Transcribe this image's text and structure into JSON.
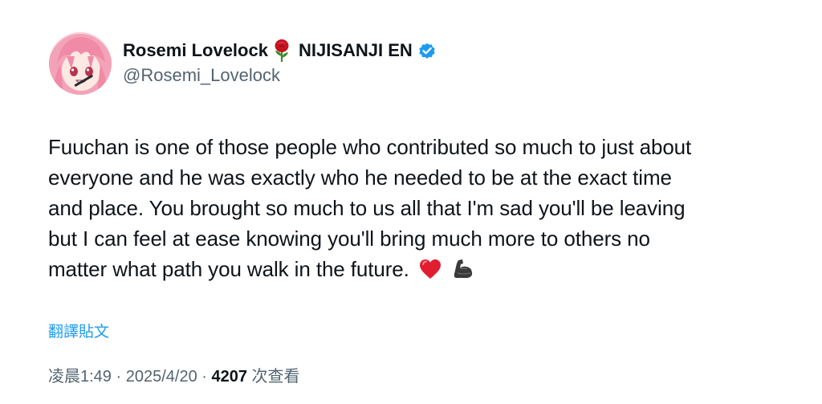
{
  "author": {
    "display_name_part1": "Rosemi Lovelock",
    "display_name_part2": "NIJISANJI EN",
    "handle": "@Rosemi_Lovelock",
    "name_icon": "rose-icon",
    "verified_icon": "verified-badge-icon",
    "verified_color": "#1d9bf0"
  },
  "tweet": {
    "lines": [
      "Fuuchan is one of those people who contributed so much to just about",
      "everyone and he was exactly who he needed to be at the exact time",
      "and place. You brought so much to us all that I'm sad you'll be leaving",
      "but I can feel at ease knowing you'll bring much more to others no",
      "matter what path you walk in the future."
    ],
    "trailing_emojis": [
      "red-heart-icon",
      "flexed-biceps-icon"
    ]
  },
  "translate_label": "翻譯貼文",
  "meta": {
    "time": "凌晨1:49",
    "separator": " · ",
    "date": "2025/4/20",
    "views_count": "4207",
    "views_label": "次查看"
  },
  "colors": {
    "text_primary": "#0f1419",
    "text_secondary": "#536471",
    "link": "#1d9bf0"
  }
}
